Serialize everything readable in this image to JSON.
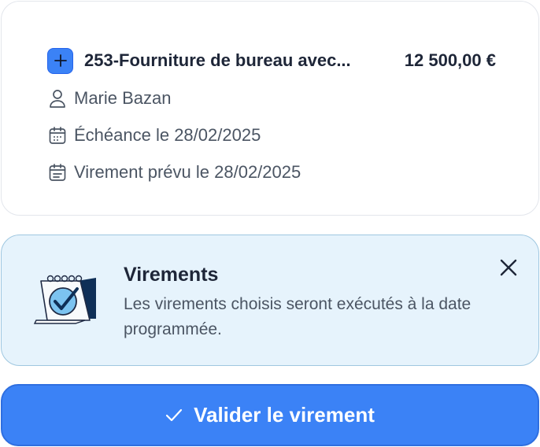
{
  "invoice": {
    "title": "253-Fourniture de bureau avec...",
    "amount": "12 500,00 €",
    "person": "Marie Bazan",
    "due": "Échéance le 28/02/2025",
    "transfer": "Virement prévu le 28/02/2025"
  },
  "banner": {
    "title": "Virements",
    "text": "Les virements choisis seront exécutés à la date programmée."
  },
  "action": {
    "label": "Valider le virement"
  },
  "icons": {
    "add": "plus-icon",
    "person": "user-icon",
    "due": "calendar-icon",
    "transfer": "calendar-transfer-icon",
    "illustration": "calendar-check-illustration",
    "close": "close-icon",
    "check": "check-icon"
  },
  "colors": {
    "primary": "#3b82f6",
    "banner_bg": "#e6f3fc",
    "banner_border": "#9fc7e0"
  }
}
